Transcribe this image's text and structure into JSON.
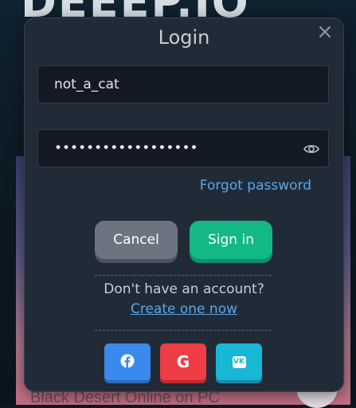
{
  "background": {
    "site_logo_text": "DEEEP.IO",
    "ad_title": "Black Desert Online on PC"
  },
  "modal": {
    "title": "Login",
    "username_value": "not_a_cat",
    "password_value": "******************",
    "forgot_password": "Forgot password",
    "cancel_label": "Cancel",
    "signin_label": "Sign in",
    "no_account_text": "Don't have an account?",
    "create_account_link": "Create one now",
    "social": {
      "facebook_icon": "facebook-icon",
      "google_glyph": "G",
      "vk_glyph": "VK"
    }
  },
  "colors": {
    "signin": "#13b886",
    "cancel": "#6b7480",
    "link": "#5aa7e8",
    "facebook": "#3a8aee",
    "google": "#ee3d44",
    "vk": "#18b7d5"
  }
}
